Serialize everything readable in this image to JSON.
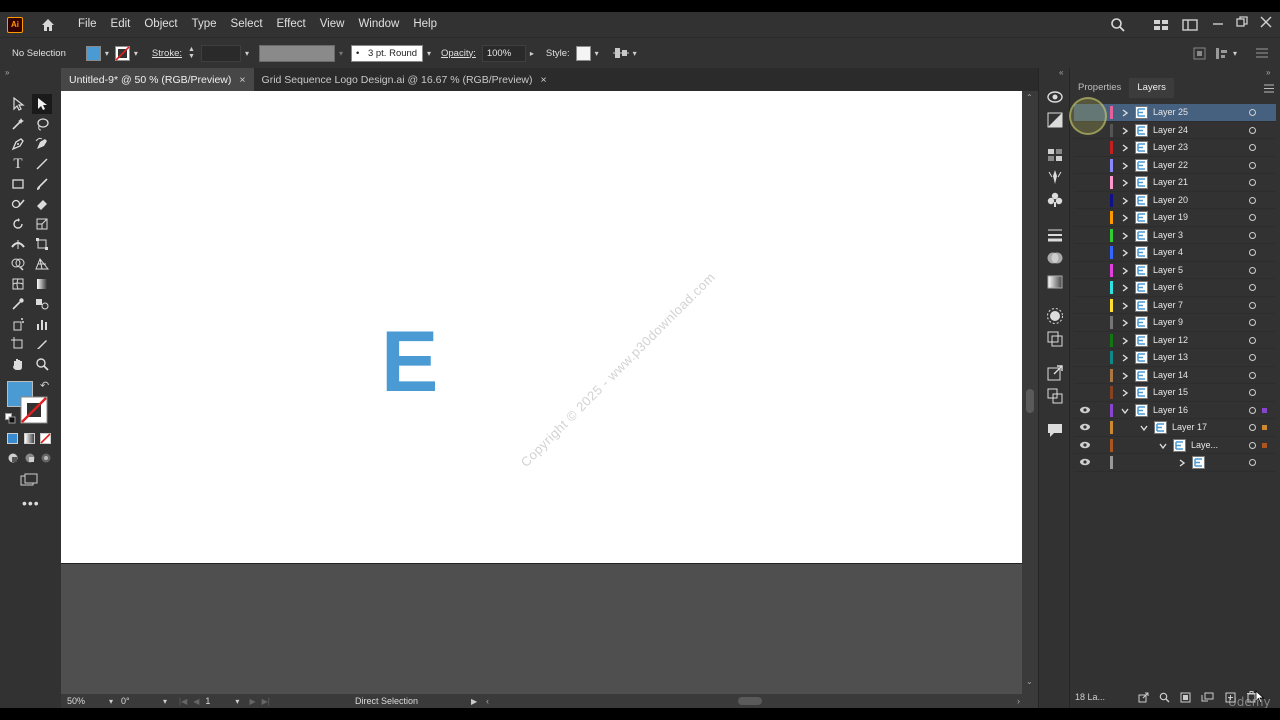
{
  "app": {
    "logo": "Ai"
  },
  "menu": [
    "File",
    "Edit",
    "Object",
    "Type",
    "Select",
    "Effect",
    "View",
    "Window",
    "Help"
  ],
  "control_bar": {
    "selection": "No Selection",
    "fill_color": "#4a9ad4",
    "stroke_label": "Stroke:",
    "brush": "3 pt. Round",
    "opacity_label": "Opacity:",
    "opacity_value": "100%",
    "style_label": "Style:"
  },
  "tabs": [
    {
      "label": "Untitled-9* @ 50 % (RGB/Preview)",
      "close": "×",
      "active": true
    },
    {
      "label": "Grid Sequence Logo Design.ai @ 16.67 % (RGB/Preview)",
      "close": "×",
      "active": false
    }
  ],
  "canvas": {
    "letter": "E",
    "letter_color": "#4a9ad4",
    "watermark": "Copyright © 2025 - www.p30download.com"
  },
  "status": {
    "zoom": "50%",
    "rotation": "0°",
    "artboard": "1",
    "tool": "Direct Selection"
  },
  "panel": {
    "tabs": [
      "Properties",
      "Layers"
    ],
    "active_tab": "Layers",
    "layers": [
      {
        "name": "Layer 25",
        "color": "#e6609a",
        "selected": true
      },
      {
        "name": "Layer 24",
        "color": "#555555"
      },
      {
        "name": "Layer 23",
        "color": "#c42020"
      },
      {
        "name": "Layer 22",
        "color": "#8a8aff"
      },
      {
        "name": "Layer 21",
        "color": "#ff99cc"
      },
      {
        "name": "Layer 20",
        "color": "#10108a"
      },
      {
        "name": "Layer 19",
        "color": "#ff9900"
      },
      {
        "name": "Layer 3",
        "color": "#33cc33"
      },
      {
        "name": "Layer 4",
        "color": "#3366ff"
      },
      {
        "name": "Layer 5",
        "color": "#e040e0"
      },
      {
        "name": "Layer 6",
        "color": "#33e0e0"
      },
      {
        "name": "Layer 7",
        "color": "#ffdd33"
      },
      {
        "name": "Layer 9",
        "color": "#777777"
      },
      {
        "name": "Layer 12",
        "color": "#117711"
      },
      {
        "name": "Layer 13",
        "color": "#118888"
      },
      {
        "name": "Layer 14",
        "color": "#aa7744"
      },
      {
        "name": "Layer 15",
        "color": "#884422"
      },
      {
        "name": "Layer 16",
        "color": "#8844cc",
        "visible": true,
        "expanded": true
      },
      {
        "name": "Layer 17",
        "color": "#cc8833",
        "visible": true,
        "expanded": true,
        "depth": 1
      },
      {
        "name": "Laye...",
        "color": "#aa5522",
        "visible": true,
        "expanded": true,
        "depth": 2
      },
      {
        "name": "",
        "color": "#999999",
        "visible": true,
        "depth": 3
      }
    ],
    "footer_count": "18 La..."
  },
  "watermark_brand": "Udemy"
}
